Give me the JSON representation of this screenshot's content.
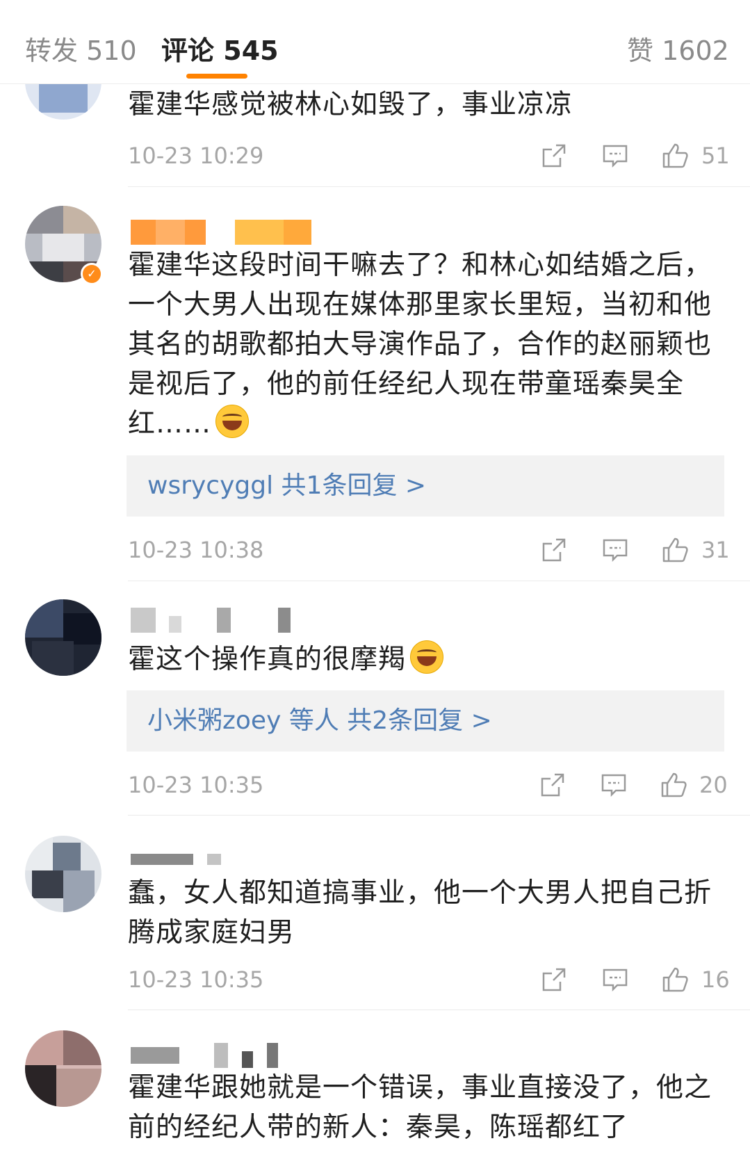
{
  "tabs": {
    "repost_label": "转发",
    "repost_count": "510",
    "comment_label": "评论",
    "comment_count": "545",
    "like_label": "赞",
    "like_count": "1602"
  },
  "icons": {
    "share": "share-icon",
    "reply": "comment-icon",
    "like": "thumbs-up-icon",
    "badge": "verified-badge-icon"
  },
  "colors": {
    "accent": "#ff8200",
    "link": "#4f7db5",
    "meta": "#a6a6a6"
  },
  "comments": [
    {
      "text": "霍建华感觉被林心如毁了，事业凉凉",
      "time": "10-23 10:29",
      "likes": "51"
    },
    {
      "text": "霍建华这段时间干嘛去了？和林心如结婚之后，一个大男人出现在媒体那里家长里短，当初和他其名的胡歌都拍大导演作品了，合作的赵丽颖也是视后了，他的前任经纪人现在带童瑶秦昊全红……",
      "reply_summary": "wsrycyggl  共1条回复 >",
      "time": "10-23 10:38",
      "likes": "31"
    },
    {
      "text": "霍这个操作真的很摩羯",
      "reply_summary": "小米粥zoey 等人  共2条回复 >",
      "time": "10-23 10:35",
      "likes": "20"
    },
    {
      "text": "蠢，女人都知道搞事业，他一个大男人把自己折腾成家庭妇男",
      "time": "10-23 10:35",
      "likes": "16"
    },
    {
      "text": "霍建华跟她就是一个错误，事业直接没了，他之前的经纪人带的新人：秦昊，陈瑶都红了"
    }
  ]
}
